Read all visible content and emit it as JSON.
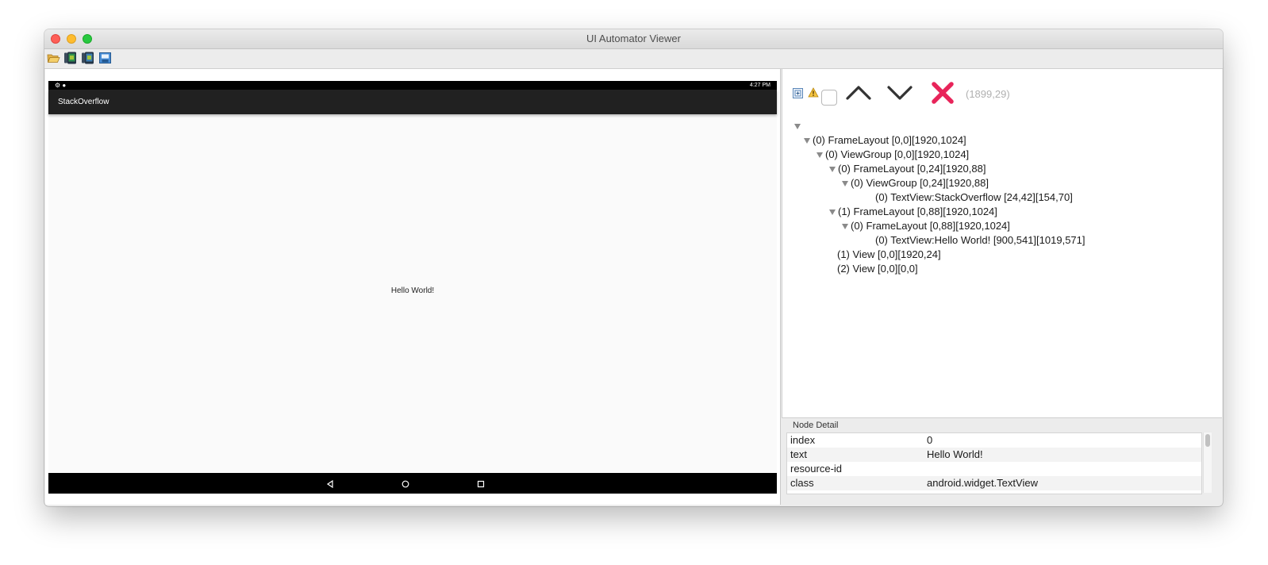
{
  "window": {
    "title": "UI Automator Viewer"
  },
  "toolbar": {
    "buttons": [
      {
        "icon": "open-folder-icon"
      },
      {
        "icon": "device-screenshot-icon"
      },
      {
        "icon": "device-screenshot-compressed-icon"
      },
      {
        "icon": "save-icon"
      }
    ]
  },
  "device": {
    "status_time": "4:27 PM",
    "app_title": "StackOverflow",
    "content_text": "Hello World!"
  },
  "hierarchy": {
    "pointer_coords": "(1899,29)",
    "nodes": [
      {
        "label": "(0) FrameLayout [0,0][1920,1024]",
        "depth": 1,
        "expanded": true
      },
      {
        "label": "(0) ViewGroup [0,0][1920,1024]",
        "depth": 2,
        "expanded": true
      },
      {
        "label": "(0) FrameLayout [0,24][1920,88]",
        "depth": 3,
        "expanded": true
      },
      {
        "label": "(0) ViewGroup [0,24][1920,88]",
        "depth": 4,
        "expanded": true
      },
      {
        "label": "(0) TextView:StackOverflow [24,42][154,70]",
        "depth": 5,
        "expanded": false
      },
      {
        "label": "(1) FrameLayout [0,88][1920,1024]",
        "depth": 3,
        "expanded": true
      },
      {
        "label": "(0) FrameLayout [0,88][1920,1024]",
        "depth": 4,
        "expanded": true
      },
      {
        "label": "(0) TextView:Hello World! [900,541][1019,571]",
        "depth": 5,
        "expanded": false
      },
      {
        "label": "(1) View [0,0][1920,24]",
        "depth": 2,
        "expanded": false
      },
      {
        "label": "(2) View [0,0][0,0]",
        "depth": 2,
        "expanded": false
      }
    ]
  },
  "node_detail": {
    "title": "Node Detail",
    "rows": [
      {
        "key": "index",
        "value": "0"
      },
      {
        "key": "text",
        "value": "Hello World!"
      },
      {
        "key": "resource-id",
        "value": ""
      },
      {
        "key": "class",
        "value": "android.widget.TextView"
      }
    ]
  }
}
